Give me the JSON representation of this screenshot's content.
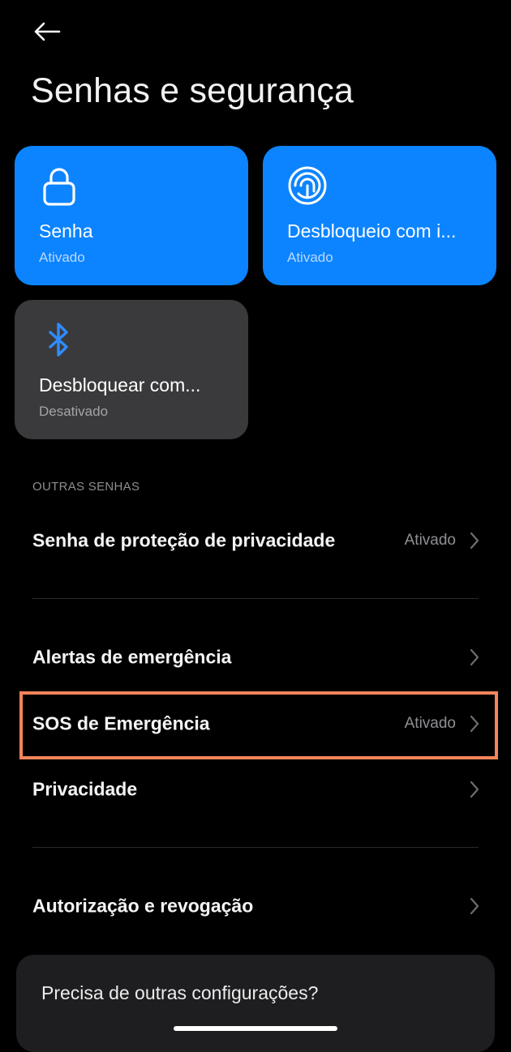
{
  "header": {
    "back_icon": "arrow-left-icon",
    "title": "Senhas e segurança"
  },
  "cards": [
    {
      "icon": "lock-icon",
      "title": "Senha",
      "status": "Ativado",
      "color": "#0c84ff"
    },
    {
      "icon": "face-unlock-icon",
      "title": "Desbloqueio com i...",
      "status": "Ativado",
      "color": "#0c84ff"
    },
    {
      "icon": "bluetooth-icon",
      "title": "Desbloquear com...",
      "status": "Desativado",
      "color": "#3a3a3c"
    }
  ],
  "section": {
    "label": "OUTRAS SENHAS"
  },
  "rows": [
    {
      "label": "Senha de proteção de privacidade",
      "value": "Ativado"
    },
    {
      "label": "Alertas de emergência",
      "value": ""
    },
    {
      "label": "SOS de Emergência",
      "value": "Ativado"
    },
    {
      "label": "Privacidade",
      "value": ""
    },
    {
      "label": "Autorização e revogação",
      "value": ""
    }
  ],
  "help": {
    "text": "Precisa de outras configurações?"
  },
  "colors": {
    "accent": "#0c84ff",
    "highlight": "#f4845a",
    "background": "#000000"
  }
}
